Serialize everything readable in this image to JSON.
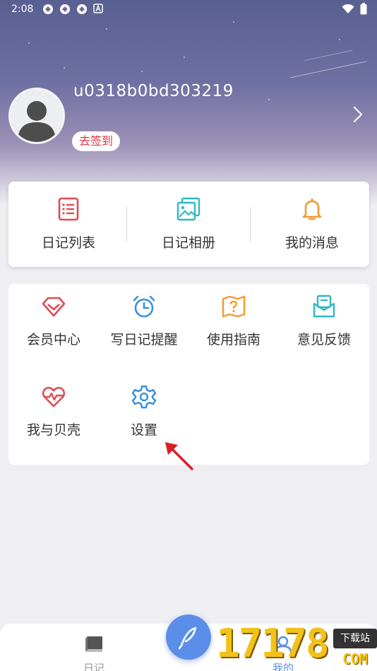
{
  "status": {
    "time": "2:08"
  },
  "profile": {
    "username": "u0318b0bd303219",
    "signin_label": "去签到"
  },
  "quick_actions": [
    {
      "label": "日记列表",
      "icon": "list-icon",
      "color": "#e04a52"
    },
    {
      "label": "日记相册",
      "icon": "photo-album-icon",
      "color": "#2fb8c4"
    },
    {
      "label": "我的消息",
      "icon": "bell-icon",
      "color": "#f29b2f"
    }
  ],
  "grid_items": [
    {
      "label": "会员中心",
      "icon": "diamond-icon",
      "color": "#e04a52"
    },
    {
      "label": "写日记提醒",
      "icon": "alarm-clock-icon",
      "color": "#3b8fe0"
    },
    {
      "label": "使用指南",
      "icon": "guide-map-icon",
      "color": "#f29b2f"
    },
    {
      "label": "意见反馈",
      "icon": "feedback-mail-icon",
      "color": "#2fb8c4"
    },
    {
      "label": "我与贝壳",
      "icon": "heart-pulse-icon",
      "color": "#e04a52"
    },
    {
      "label": "设置",
      "icon": "gear-icon",
      "color": "#3b8fe0"
    }
  ],
  "tabbar": {
    "tabs": [
      {
        "label": "日记",
        "icon": "diary-book-icon"
      },
      {
        "label": "我的",
        "icon": "profile-icon"
      }
    ],
    "fab_icon": "feather-pen-icon"
  },
  "watermark": {
    "digits": "17178",
    "badge": "下载站",
    "suffix": "COM"
  }
}
